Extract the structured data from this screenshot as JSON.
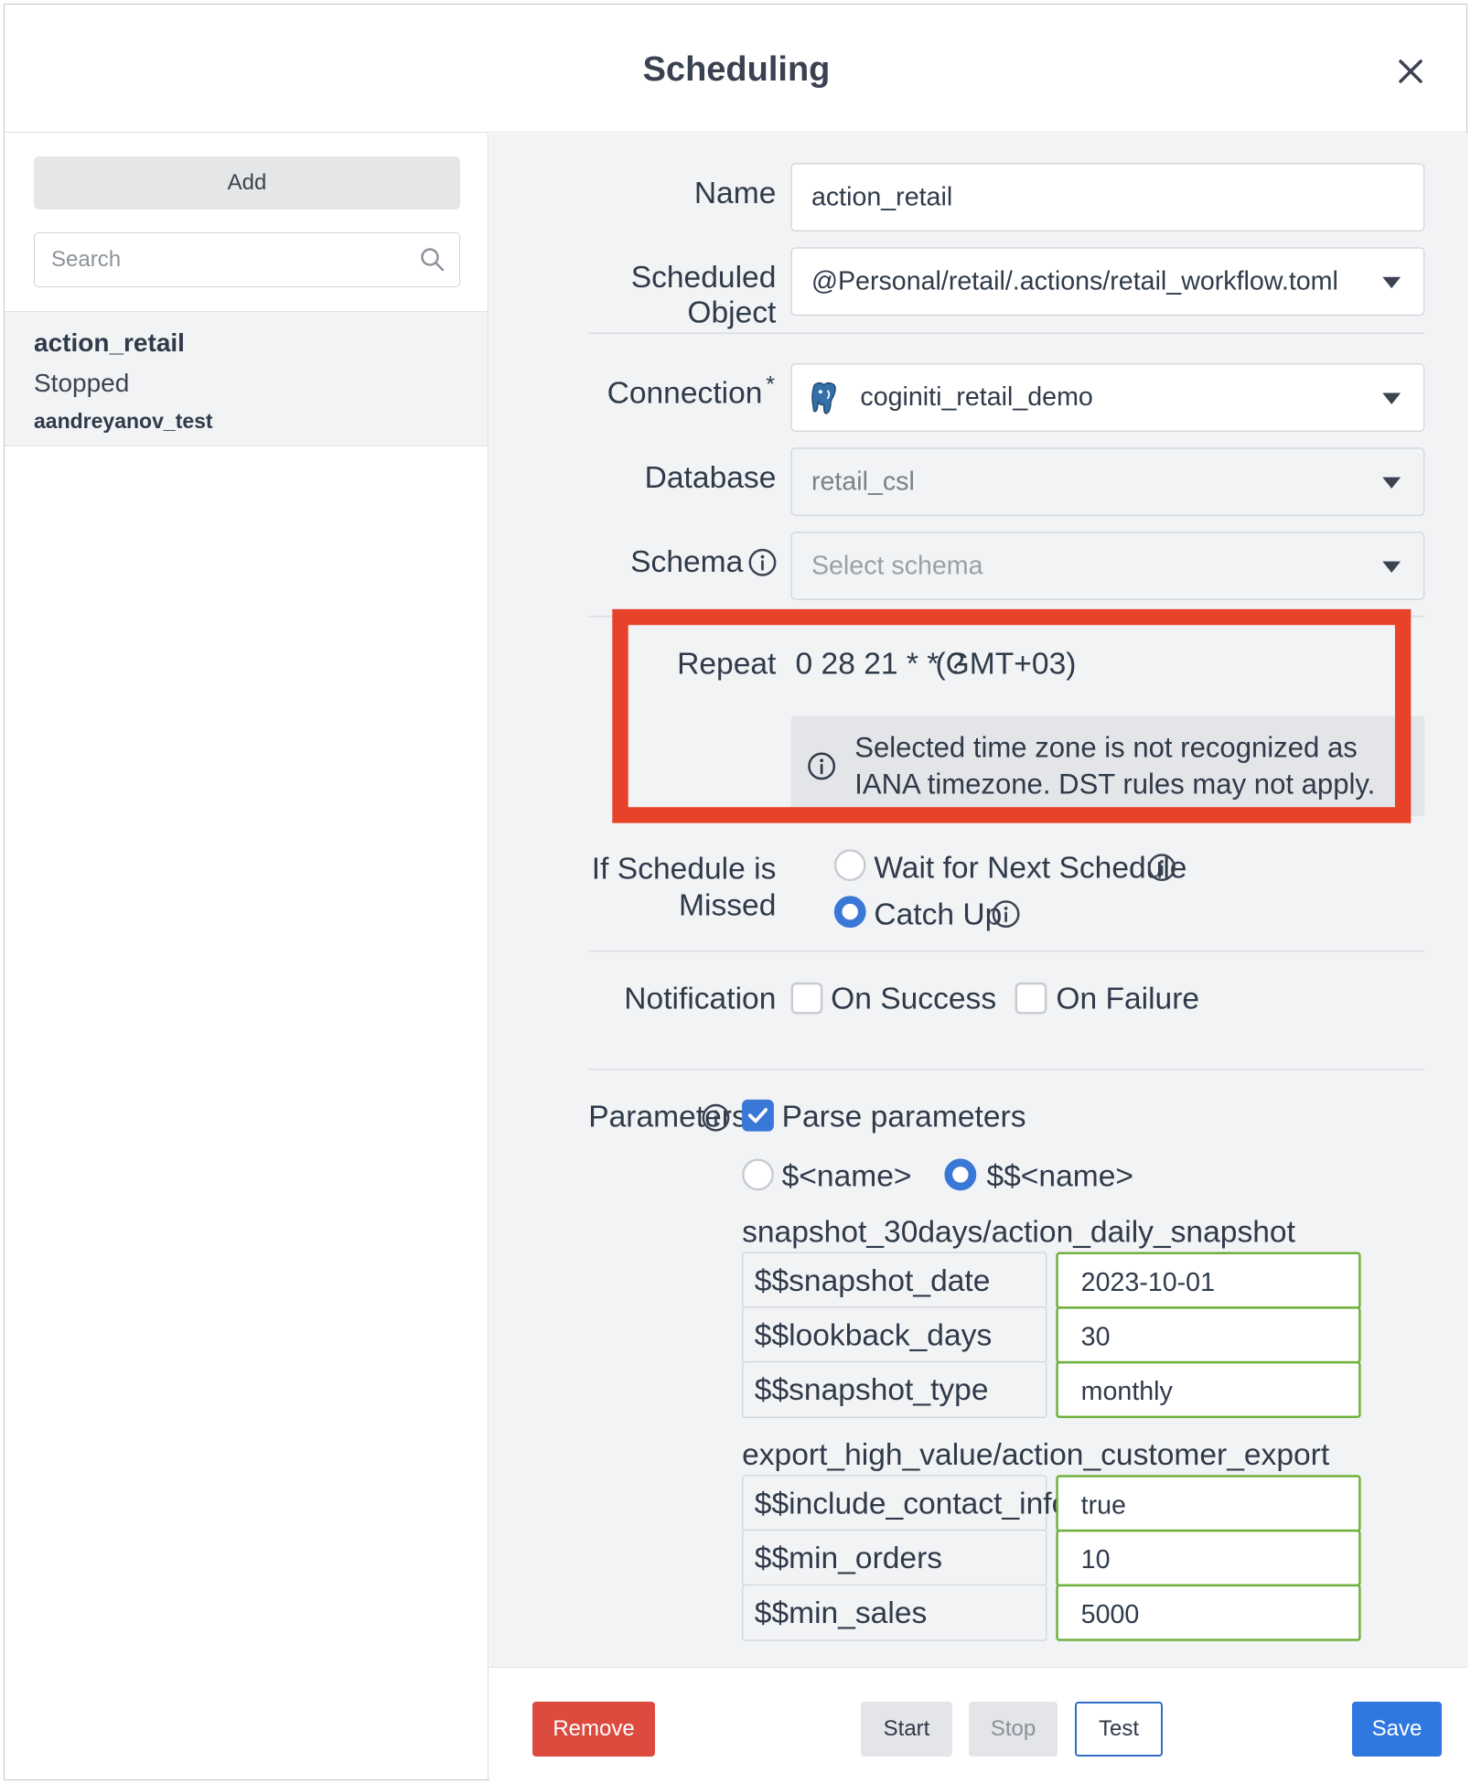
{
  "dialog": {
    "title": "Scheduling"
  },
  "sidebar": {
    "add_label": "Add",
    "search_placeholder": "Search",
    "items": [
      {
        "name": "action_retail",
        "status": "Stopped",
        "owner": "aandreyanov_test"
      }
    ]
  },
  "form": {
    "name_label": "Name",
    "name_value": "action_retail",
    "object_label": "Scheduled Object",
    "object_value": "@Personal/retail/.actions/retail_workflow.toml",
    "connection_label": "Connection",
    "connection_required": "*",
    "connection_value": "coginiti_retail_demo",
    "database_label": "Database",
    "database_value": "retail_csl",
    "schema_label": "Schema",
    "schema_placeholder": "Select schema",
    "repeat_label": "Repeat",
    "repeat_value": "0 28 21 * * ?",
    "repeat_tz": "(GMT+03)",
    "tz_warning": "Selected time zone is not recognized as IANA timezone. DST rules may not apply.",
    "missed_label_line1": "If Schedule is",
    "missed_label_line2": "Missed",
    "missed_options": [
      {
        "label": "Wait for Next Schedule",
        "selected": false
      },
      {
        "label": "Catch Up",
        "selected": true
      }
    ],
    "notification_label": "Notification",
    "notification_options": [
      {
        "label": "On Success",
        "checked": false
      },
      {
        "label": "On Failure",
        "checked": false
      }
    ],
    "parameters_label": "Parameters",
    "parse_label": "Parse parameters",
    "parse_checked": true,
    "syntax_options": [
      {
        "label": "$<name>",
        "selected": false
      },
      {
        "label": "$$<name>",
        "selected": true
      }
    ],
    "param_groups": [
      {
        "title": "snapshot_30days/action_daily_snapshot",
        "params": [
          {
            "key": "$$snapshot_date",
            "value": "2023-10-01"
          },
          {
            "key": "$$lookback_days",
            "value": "30"
          },
          {
            "key": "$$snapshot_type",
            "value": "monthly"
          }
        ]
      },
      {
        "title": "export_high_value/action_customer_export",
        "params": [
          {
            "key": "$$include_contact_info",
            "value": "true"
          },
          {
            "key": "$$min_orders",
            "value": "10"
          },
          {
            "key": "$$min_sales",
            "value": "5000"
          }
        ]
      }
    ]
  },
  "footer": {
    "remove_label": "Remove",
    "start_label": "Start",
    "stop_label": "Stop",
    "test_label": "Test",
    "save_label": "Save"
  },
  "colors": {
    "highlight": "#e8432a",
    "primary": "#2f78e0",
    "danger": "#dc4b3e",
    "valid": "#6fb13d"
  },
  "icons": {
    "close": "close-icon",
    "search": "search-icon",
    "info": "info-icon",
    "postgres": "postgres-elephant-icon",
    "caret": "caret-down-icon",
    "check": "checkmark-icon"
  }
}
